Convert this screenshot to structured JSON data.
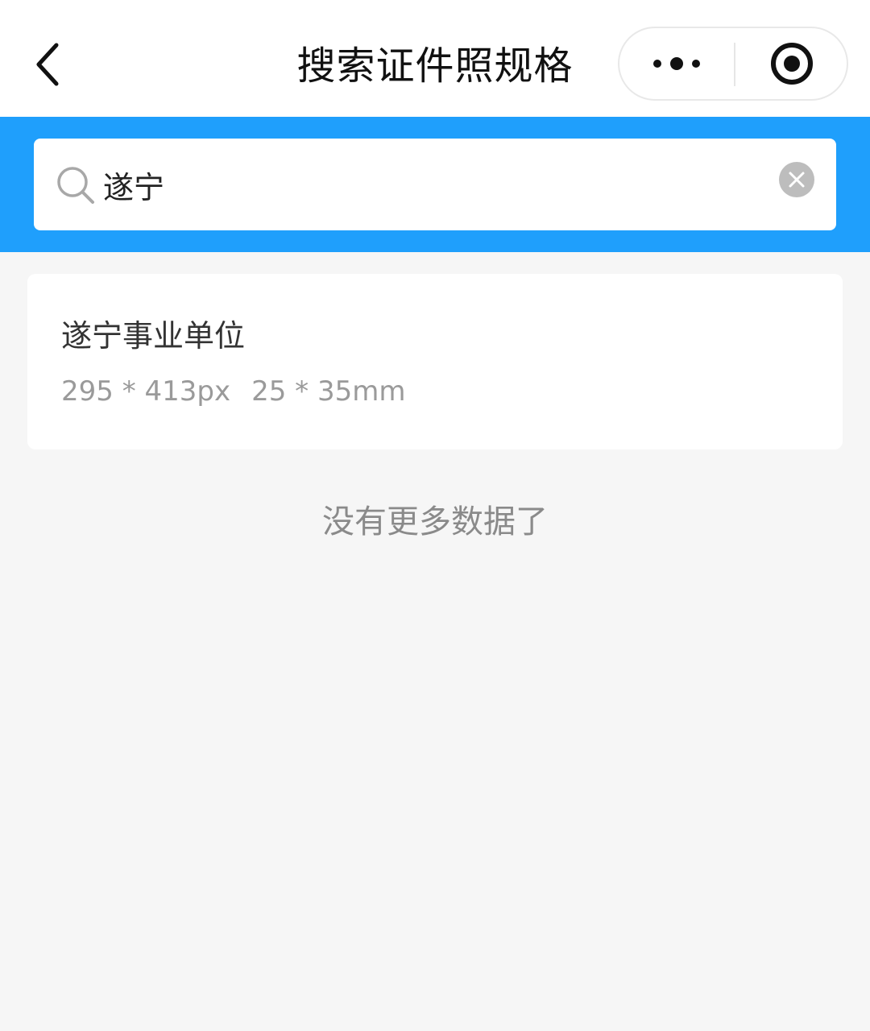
{
  "navbar": {
    "title": "搜索证件照规格",
    "back_icon": "chevron-left-icon",
    "more_icon": "more-dots-icon",
    "close_icon": "target-circle-icon"
  },
  "search": {
    "value": "遂宁",
    "icon": "search-icon",
    "clear_icon": "clear-circle-icon"
  },
  "results": [
    {
      "title": "遂宁事业单位",
      "size_px": "295 * 413px",
      "size_mm": "25 * 35mm"
    }
  ],
  "footer": {
    "no_more_text": "没有更多数据了"
  },
  "colors": {
    "accent": "#1f9ffc",
    "page_bg": "#f6f6f6",
    "card_bg": "#ffffff",
    "muted_text": "#9a9a9a"
  }
}
